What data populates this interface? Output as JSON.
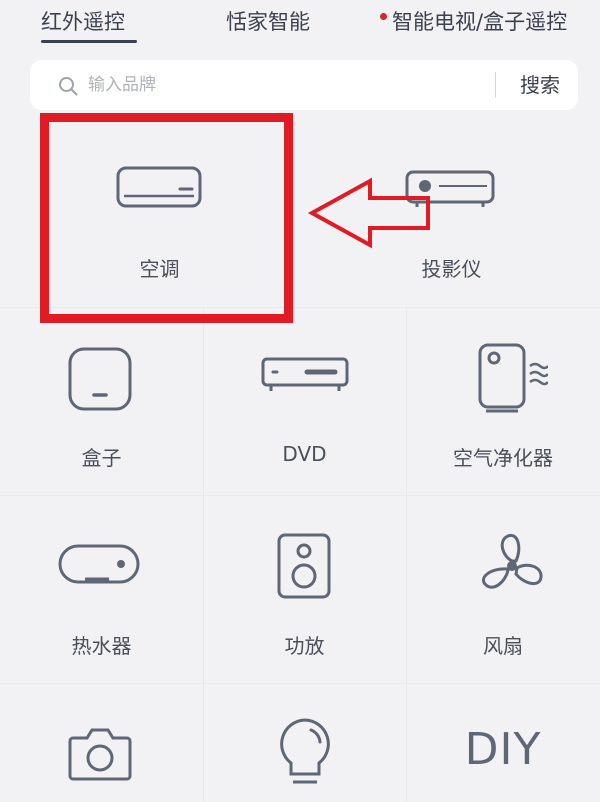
{
  "tabs": [
    {
      "label": "红外遥控",
      "active": true
    },
    {
      "label": "恬家智能",
      "active": false
    },
    {
      "label": "智能电视/盒子遥控",
      "active": false,
      "dot": true
    }
  ],
  "search": {
    "placeholder": "输入品牌",
    "button_label": "搜索"
  },
  "devices": [
    {
      "label": "空调",
      "icon": "air-conditioner-icon"
    },
    {
      "label": "投影仪",
      "icon": "projector-icon"
    },
    {
      "label": "盒子",
      "icon": "box-icon"
    },
    {
      "label": "DVD",
      "icon": "dvd-icon"
    },
    {
      "label": "空气净化器",
      "icon": "air-purifier-icon"
    },
    {
      "label": "热水器",
      "icon": "water-heater-icon"
    },
    {
      "label": "功放",
      "icon": "amplifier-icon"
    },
    {
      "label": "风扇",
      "icon": "fan-icon"
    },
    {
      "label": "",
      "icon": "camera-icon"
    },
    {
      "label": "",
      "icon": "light-bulb-icon"
    },
    {
      "label": "DIY",
      "icon": "diy-icon"
    }
  ],
  "colors": {
    "highlight": "#e01b24",
    "icon_stroke": "#5f6676",
    "text": "#4a4f5a"
  }
}
